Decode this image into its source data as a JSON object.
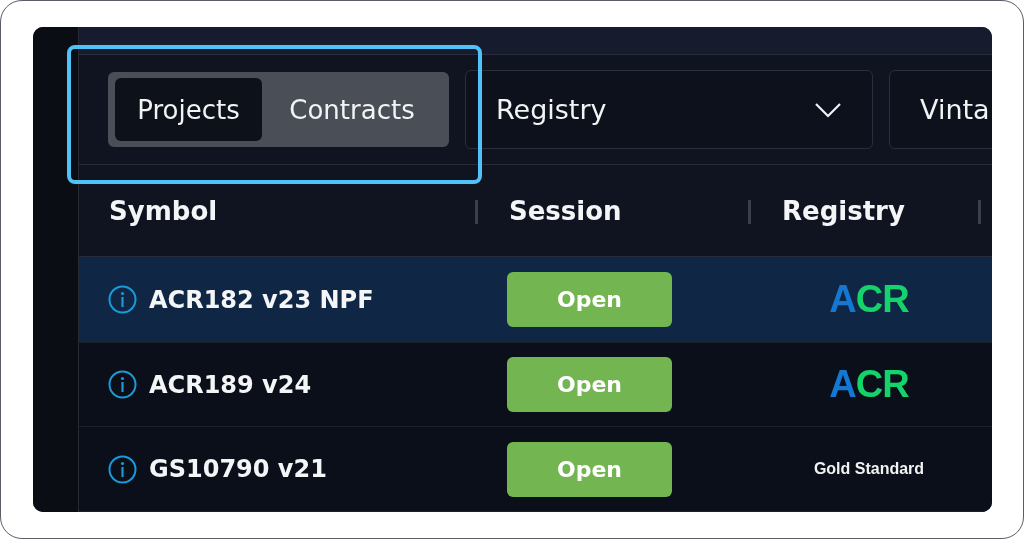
{
  "filters": {
    "view_toggle": [
      {
        "label": "Projects",
        "selected": true
      },
      {
        "label": "Contracts",
        "selected": false
      }
    ],
    "dropdowns": [
      {
        "label": "Registry",
        "chevron": true
      },
      {
        "label": "Vinta"
      }
    ]
  },
  "table": {
    "columns": [
      "Symbol",
      "Session",
      "Registry"
    ],
    "rows": [
      {
        "symbol": "ACR182 v23 NPF",
        "session": "Open",
        "registry": {
          "kind": "acr",
          "text": "ACR"
        },
        "selected": true
      },
      {
        "symbol": "ACR189 v24",
        "session": "Open",
        "registry": {
          "kind": "acr",
          "text": "ACR"
        },
        "selected": false
      },
      {
        "symbol": "GS10790 v21",
        "session": "Open",
        "registry": {
          "kind": "gold",
          "text": "Gold Standard"
        },
        "selected": false
      }
    ]
  }
}
